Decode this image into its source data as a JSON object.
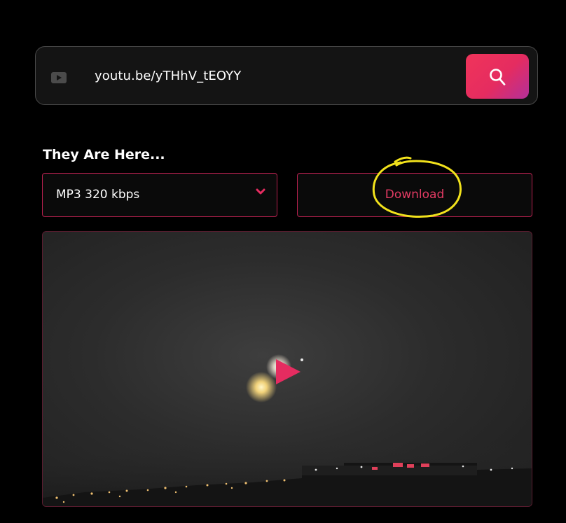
{
  "search": {
    "url_value": "youtu.be/yTHhV_tEOYY",
    "source_icon": "youtube-icon",
    "button_icon": "search-icon"
  },
  "video": {
    "title": "They Are Here..."
  },
  "format_select": {
    "selected": "MP3 320 kbps",
    "icon": "chevron-down-icon"
  },
  "download": {
    "label": "Download"
  },
  "preview": {
    "play_icon": "play-icon"
  },
  "colors": {
    "accent": "#e52c60",
    "accent_gradient_end": "#b3309a",
    "border_accent": "#b5204e",
    "annotation": "#f2e21c",
    "background": "#000000"
  }
}
